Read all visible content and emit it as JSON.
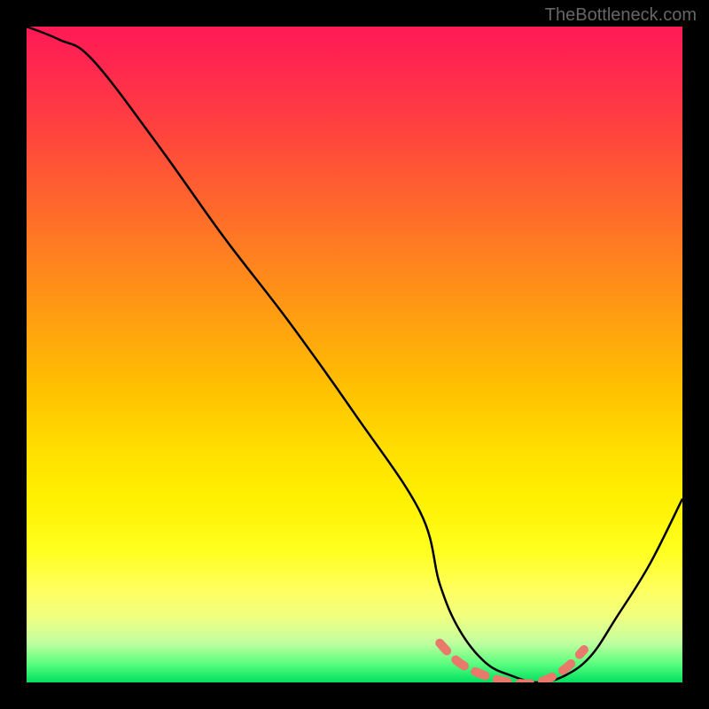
{
  "watermark": "TheBottleneck.com",
  "chart_data": {
    "type": "line",
    "title": "",
    "xlabel": "",
    "ylabel": "",
    "xlim": [
      0,
      100
    ],
    "ylim": [
      0,
      100
    ],
    "grid": false,
    "legend": false,
    "notes": "Gradient background from red (top, high bottleneck) through orange/yellow to green (bottom, low bottleneck). Black V-shaped curve; pink dotted segment marks the optimal trough.",
    "series": [
      {
        "name": "bottleneck-curve",
        "x": [
          0,
          5,
          10,
          20,
          30,
          40,
          50,
          60,
          63,
          66,
          70,
          74,
          78,
          82,
          86,
          90,
          95,
          100
        ],
        "values": [
          100,
          98,
          95,
          82,
          68,
          55,
          41,
          26,
          15,
          8,
          3,
          1,
          0,
          1,
          4,
          10,
          18,
          28
        ]
      },
      {
        "name": "optimal-range-marker",
        "x": [
          63,
          66,
          70,
          74,
          78,
          82,
          85
        ],
        "values": [
          6,
          3,
          1,
          0,
          0,
          2,
          5
        ]
      }
    ]
  }
}
